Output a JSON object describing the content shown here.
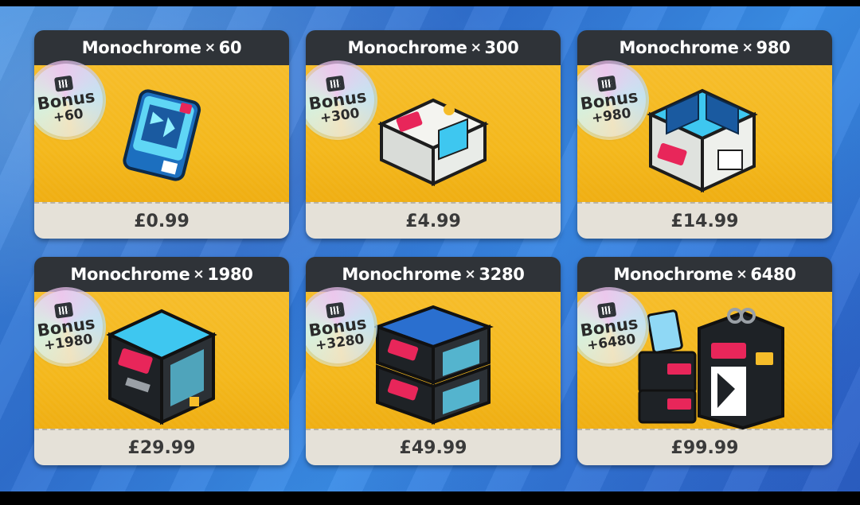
{
  "shop": {
    "cards": [
      {
        "title": "Monochrome",
        "times": "×",
        "qty": "60",
        "bonus_label": "Bonus",
        "bonus_amount": "+60",
        "price": "£0.99"
      },
      {
        "title": "Monochrome",
        "times": "×",
        "qty": "300",
        "bonus_label": "Bonus",
        "bonus_amount": "+300",
        "price": "£4.99"
      },
      {
        "title": "Monochrome",
        "times": "×",
        "qty": "980",
        "bonus_label": "Bonus",
        "bonus_amount": "+980",
        "price": "£14.99"
      },
      {
        "title": "Monochrome",
        "times": "×",
        "qty": "1980",
        "bonus_label": "Bonus",
        "bonus_amount": "+1980",
        "price": "£29.99"
      },
      {
        "title": "Monochrome",
        "times": "×",
        "qty": "3280",
        "bonus_label": "Bonus",
        "bonus_amount": "+3280",
        "price": "£49.99"
      },
      {
        "title": "Monochrome",
        "times": "×",
        "qty": "6480",
        "bonus_label": "Bonus",
        "bonus_amount": "+6480",
        "price": "£99.99"
      }
    ],
    "icons": [
      "film-reel-icon",
      "monochrome-pack-icon"
    ],
    "colors": {
      "card_body": "#f4b81c",
      "card_header": "#2f3338",
      "card_footer": "#e5e1d8",
      "background": "#3a86e0",
      "pack_cyan": "#3ec7f0",
      "pack_pink": "#e8265a"
    }
  }
}
